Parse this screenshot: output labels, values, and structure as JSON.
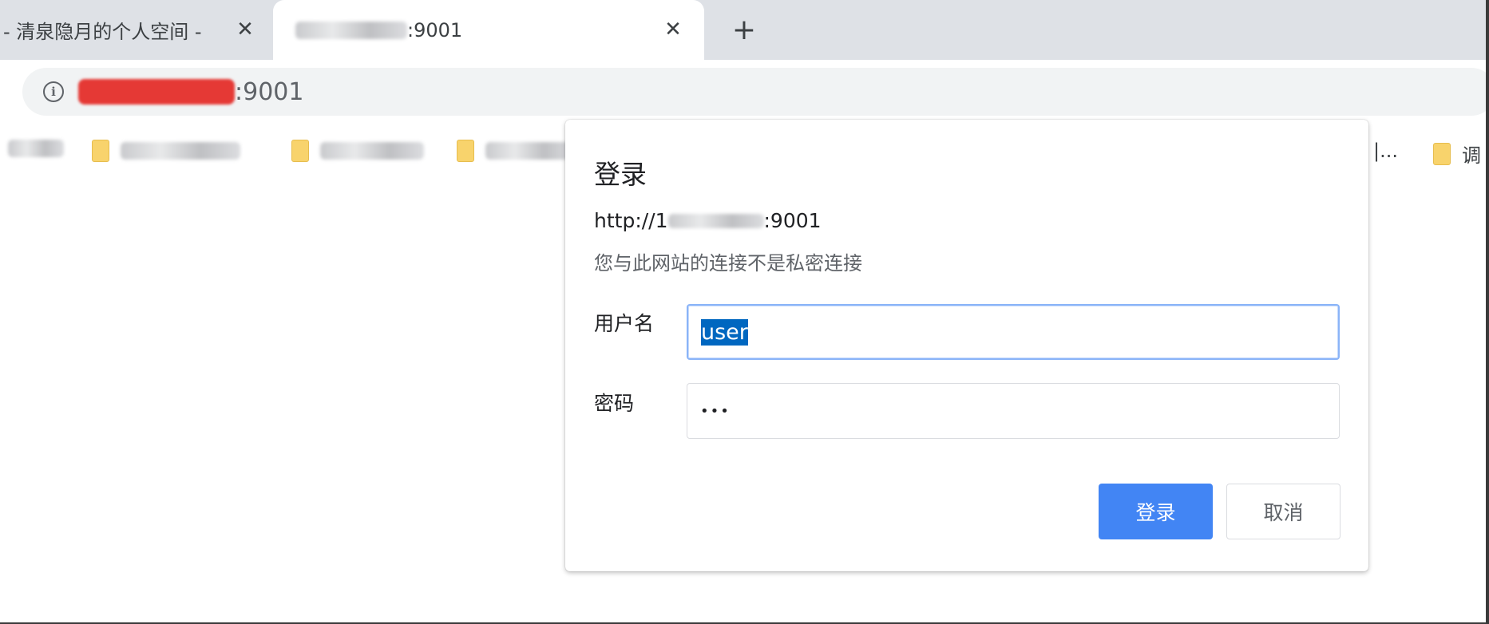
{
  "tabs": [
    {
      "title": "- 清泉隐月的个人空间 -",
      "active": false
    },
    {
      "title_suffix": ":9001",
      "active": true
    }
  ],
  "tab_close_glyph": "✕",
  "new_tab_glyph": "+",
  "omnibox": {
    "url_port": ":9001",
    "info_glyph": "i"
  },
  "bookmarks": {
    "trailing_text": "|...",
    "last_folder_label": "调"
  },
  "dialog": {
    "title": "登录",
    "origin_prefix": "http://1",
    "origin_suffix": ":9001",
    "warning": "您与此网站的连接不是私密连接",
    "username_label": "用户名",
    "username_value": "user",
    "password_label": "密码",
    "password_mask": "•••",
    "login_button": "登录",
    "cancel_button": "取消"
  },
  "colors": {
    "tabstrip": "#dee1e6",
    "primary_button": "#4285f4",
    "selection": "#0067c0",
    "redaction": "#e53935",
    "folder": "#f8d36c"
  }
}
